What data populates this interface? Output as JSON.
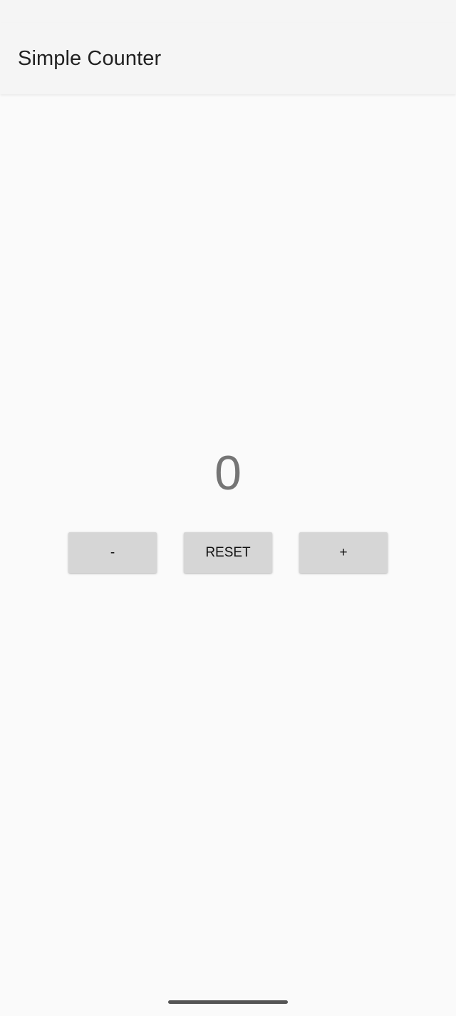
{
  "app_bar": {
    "title": "Simple Counter"
  },
  "counter": {
    "value": "0"
  },
  "buttons": {
    "decrement_label": "-",
    "reset_label": "RESET",
    "increment_label": "+"
  },
  "colors": {
    "background": "#fafafa",
    "app_bar": "#f5f5f5",
    "button": "#d6d6d6",
    "count_text": "#757575"
  }
}
